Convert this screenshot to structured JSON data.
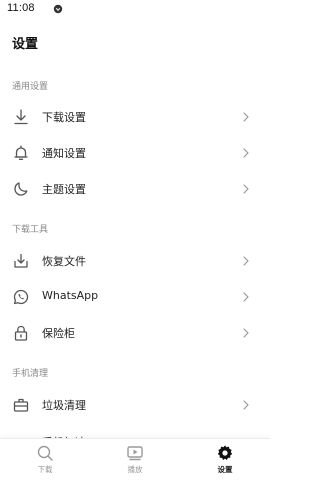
{
  "status_bar": {
    "time": "11:08"
  },
  "page": {
    "title": "设置"
  },
  "sections": {
    "general": {
      "header": "通用设置"
    },
    "download_tools": {
      "header": "下载工具"
    },
    "phone_clean": {
      "header": "手机清理"
    }
  },
  "rows": {
    "download_settings": "下载设置",
    "notify_settings": "通知设置",
    "theme_settings": "主题设置",
    "restore_files": "恢复文件",
    "whatsapp": "WhatsApp",
    "vault": "保险柜",
    "junk_clean": "垃圾清理",
    "partial": "手机加速"
  },
  "bottom_nav": {
    "download": "下载",
    "play": "播放",
    "settings": "设置",
    "active": "settings"
  },
  "icons": {
    "download": "download-icon",
    "bell": "bell-icon",
    "moon": "moon-icon",
    "restore": "restore-download-icon",
    "whatsapp": "whatsapp-icon",
    "lock": "lock-icon",
    "junk": "junk-clean-icon",
    "search": "search-icon",
    "play": "play-icon",
    "gear": "gear-icon",
    "chevron": "chevron-right-icon"
  },
  "colors": {
    "icon": "#555555",
    "chevron": "#999999",
    "active": "#111111",
    "inactive": "#9a9a9a"
  }
}
